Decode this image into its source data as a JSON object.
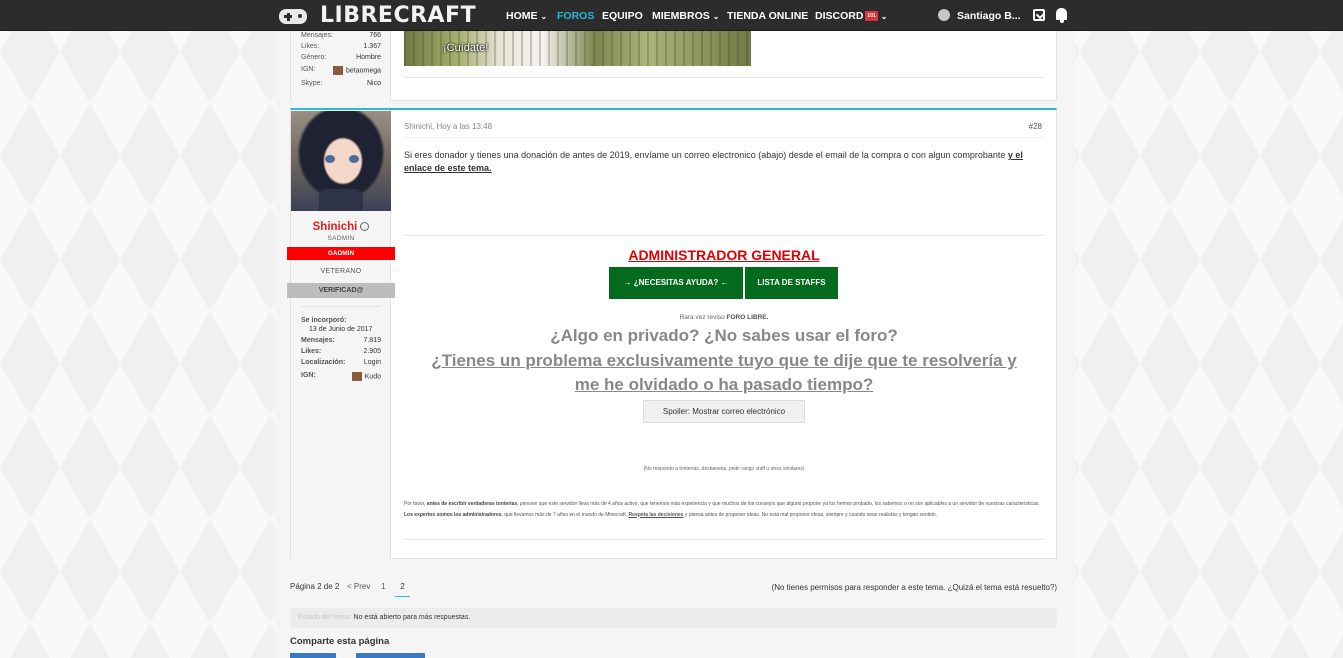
{
  "nav": {
    "logo_text": "LIBRECRAFT",
    "items": [
      {
        "label": "HOME",
        "chevron": "⌄"
      },
      {
        "label": "FOROS"
      },
      {
        "label": "EQUIPO"
      },
      {
        "label": "MIEMBROS",
        "chevron": "⌄"
      },
      {
        "label": "TIENDA ONLINE"
      },
      {
        "label": "DISCORD",
        "badge": "101",
        "chevron": "⌄"
      }
    ],
    "active_item": "FOROS",
    "user_name": "Santiago B...",
    "accent_color": "#2bb9d6"
  },
  "prev_post": {
    "stats": [
      {
        "label": "Mensajes:",
        "value": "766"
      },
      {
        "label": "Likes:",
        "value": "1.367"
      },
      {
        "label": "Género:",
        "value": "Hombre"
      },
      {
        "label": "IGN:",
        "value": "betaomega"
      },
      {
        "label": "Skype:",
        "value": "Nico"
      }
    ],
    "image_caption": "¡Cuídate!"
  },
  "post": {
    "author": "Shinichi",
    "user_title": "SADMIN",
    "role_badge": "GADMIN",
    "rank": "VETERANO",
    "verified": "VERIFICAD@",
    "joined_label": "Se incorporó:",
    "joined_value": "13 de Junio de 2017",
    "stats": [
      {
        "label": "Mensajes:",
        "value": "7.819"
      },
      {
        "label": "Likes:",
        "value": "2.905"
      },
      {
        "label": "Localización:",
        "value": "Login"
      },
      {
        "label": "IGN:",
        "value": "Kudo"
      }
    ],
    "meta": "Shinichi, Hoy a las 13:48",
    "number": "#28",
    "body": "Si eres donador y tienes una donación de antes de 2019, envíame un correo electronico (abajo) desde el email de la compra o con algun comprobante",
    "body_link": "y el enlace de este tema.",
    "sig": {
      "title": "ADMINISTRADOR GENERAL",
      "btn_help": "→ ¿NECESITAS AYUDA? ←",
      "btn_staff": "LISTA DE STAFFS",
      "small_pre": "Rara vez reviso",
      "small_bold": "FORO LIBRE.",
      "big1": "¿Algo en privado? ¿No sabes usar el foro?",
      "big2": "¿Tienes un problema exclusivamente tuyo que te dije que te resolvería y",
      "big3": "me he olvidado o ha pasado tiempo?",
      "spoiler": "Spoiler: Mostrar correo electrónico",
      "tiny_center": "(No respondo a tonterías, desbaneos, pedir rango staff u otros similares)",
      "para_1": "Por favor,",
      "para_2": "antes de escribir verdaderas tonterías",
      "para_3": ", piensen que este servidor lleva más de 4 años activo, que tenemos más experiencia y que muchos de los consejos que alguno propone ya los hemos probado, los sabemos o no son aplicables a un servidor de nuestras características.",
      "para_4": "Los expertos somos los administradores",
      "para_5": ", que llevamos más de 7 años en el mundo de Minecraft.",
      "para_6": "Respeta las decisiones",
      "para_7": "y piensa antes de proponer ideas. No está mal proponer ideas, siempre y cuando sean realistas y tengan sentido."
    },
    "name_color": "#e02020",
    "badge_color": "#ff0000",
    "button_color": "#046b1e"
  },
  "pagination": {
    "label": "Página 2 de 2",
    "prev": "< Prev",
    "page1": "1",
    "page2": "2",
    "no_permission": "(No tienes permisos para responder a este tema. ¿Quizá el tema está resuelto?)"
  },
  "thread_status": {
    "label": "Estado del tema:",
    "value": "No está abierto para más respuestas."
  },
  "share_title": "Comparte esta página"
}
